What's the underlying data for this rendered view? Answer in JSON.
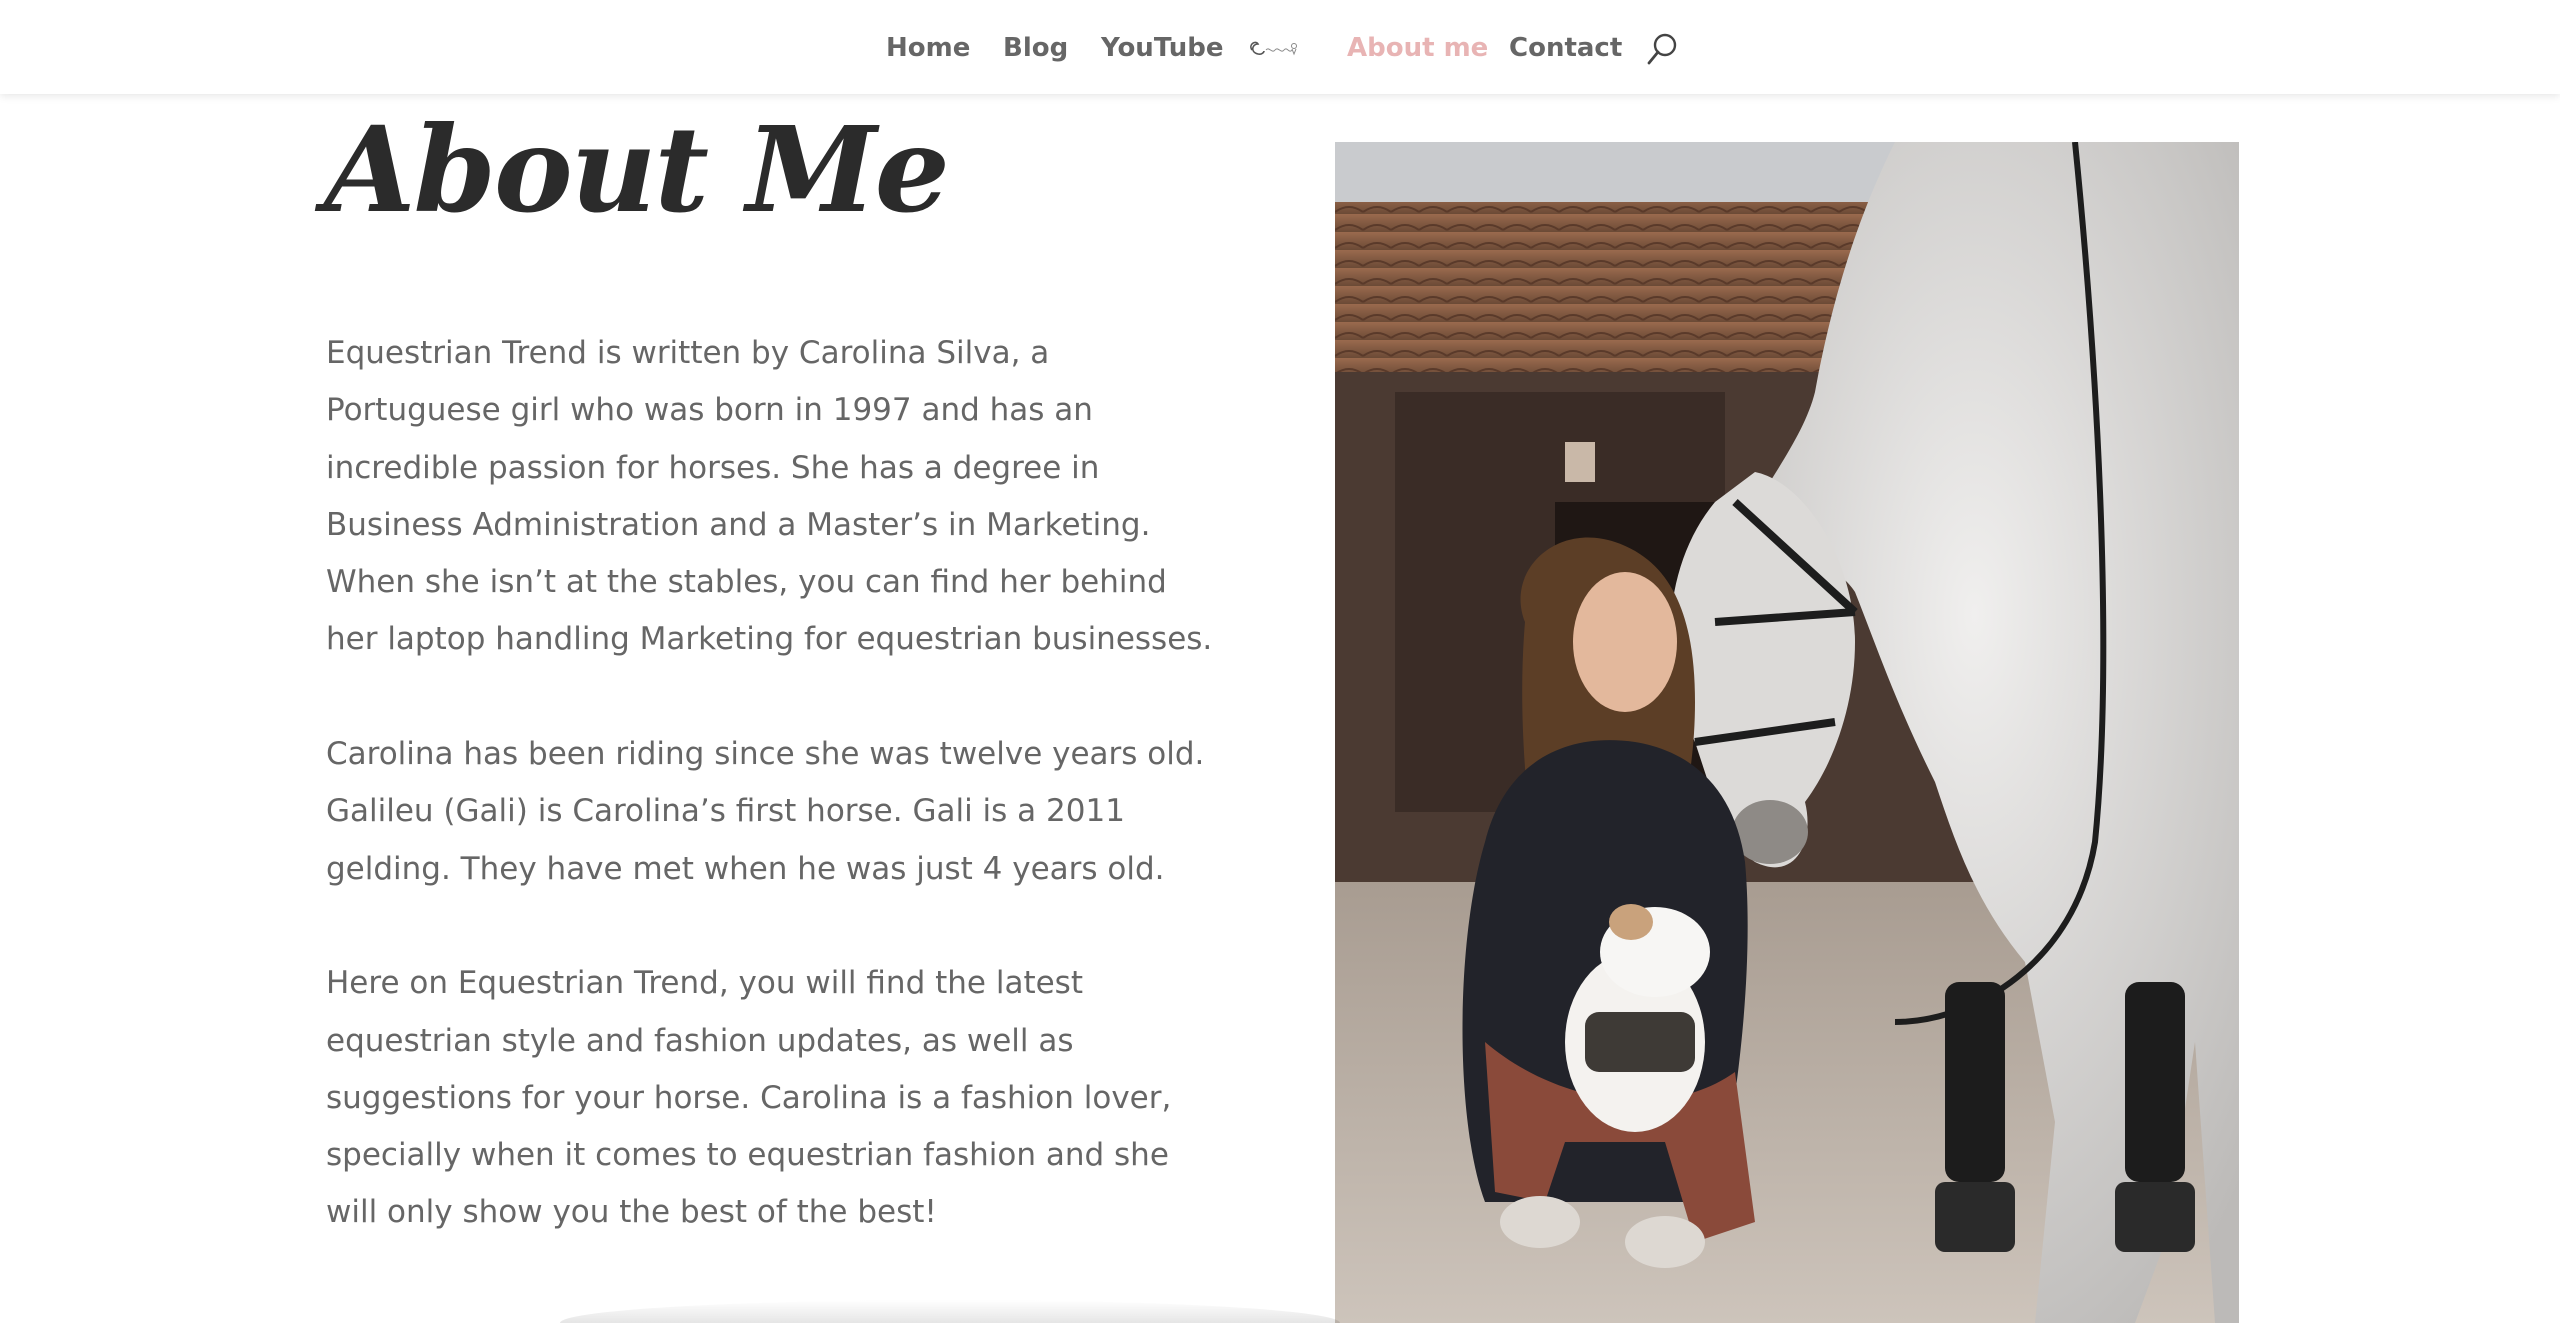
{
  "nav": {
    "items": [
      {
        "label": "Home"
      },
      {
        "label": "Blog"
      },
      {
        "label": "YouTube"
      },
      {
        "label": "About me",
        "active": true
      },
      {
        "label": "Contact"
      }
    ],
    "logo_icon": "script-logo-icon",
    "search_icon": "search-icon",
    "active_color": "#e8b4b4",
    "text_color": "#666666"
  },
  "main": {
    "title": "About Me",
    "paragraphs": [
      "Equestrian Trend is written by Carolina Silva, a Portuguese girl who was born in 1997 and has an incredible passion for horses. She has a degree in Business Administration and a Master’s in Marketing. When she isn’t at the stables, you can find her behind her laptop handling Marketing for equestrian businesses.",
      "Carolina has been riding since she was twelve years old. Galileu (Gali) is Carolina’s first horse. Gali is a 2011 gelding. They have met when he was just 4 years old.",
      "Here on Equestrian Trend, you will find the latest equestrian style and fashion updates, as well as suggestions for your horse. Carolina is a fashion lover, specially when it comes to equestrian fashion and she will only show you the best of the best!"
    ],
    "photo_alt": "Carolina crouching with a dog next to a grey horse"
  }
}
